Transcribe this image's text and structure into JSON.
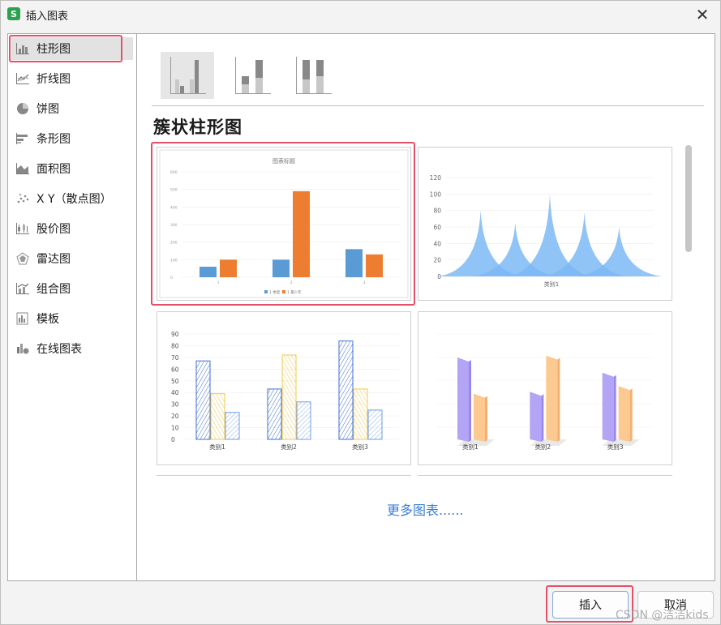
{
  "window": {
    "title": "插入图表",
    "app_icon_letter": "S"
  },
  "sidebar": {
    "items": [
      {
        "label": "柱形图",
        "icon": "bar-chart-icon"
      },
      {
        "label": "折线图",
        "icon": "line-chart-icon"
      },
      {
        "label": "饼图",
        "icon": "pie-chart-icon"
      },
      {
        "label": "条形图",
        "icon": "horizontal-bar-chart-icon"
      },
      {
        "label": "面积图",
        "icon": "area-chart-icon"
      },
      {
        "label": "X Y（散点图）",
        "icon": "scatter-chart-icon"
      },
      {
        "label": "股价图",
        "icon": "stock-chart-icon"
      },
      {
        "label": "雷达图",
        "icon": "radar-chart-icon"
      },
      {
        "label": "组合图",
        "icon": "combo-chart-icon"
      },
      {
        "label": "模板",
        "icon": "template-icon"
      },
      {
        "label": "在线图表",
        "icon": "online-chart-icon"
      }
    ],
    "selected_index": 0
  },
  "main": {
    "section_title": "簇状柱形图",
    "more_link": "更多图表......",
    "thumbs": {
      "t1": {
        "title": "图表标题",
        "ticks": [
          "600",
          "500",
          "400",
          "300",
          "200",
          "100",
          "0"
        ],
        "cats": [
          "1",
          "2",
          "3"
        ],
        "legend": [
          "1 季度",
          "1 最少年"
        ]
      },
      "t2": {
        "ticks": [
          "120",
          "100",
          "80",
          "60",
          "40",
          "20",
          "0"
        ],
        "cat": "类别1"
      },
      "t3": {
        "ticks": [
          "90",
          "80",
          "70",
          "60",
          "50",
          "40",
          "30",
          "20",
          "10",
          "0"
        ],
        "cats": [
          "类别1",
          "类别2",
          "类别3"
        ]
      },
      "t4": {
        "cats": [
          "类别1",
          "类别2",
          "类别3"
        ]
      }
    }
  },
  "chart_data": [
    {
      "type": "bar",
      "title": "图表标题",
      "categories": [
        "1",
        "2",
        "3"
      ],
      "series": [
        {
          "name": "1 季度",
          "values": [
            60,
            100,
            160
          ]
        },
        {
          "name": "1 最少年",
          "values": [
            100,
            490,
            130
          ]
        }
      ],
      "ylim": [
        0,
        600
      ],
      "colors": [
        "#5b9bd5",
        "#ed7d31"
      ]
    },
    {
      "type": "area",
      "categories": [
        "类别1"
      ],
      "peaks": [
        80,
        65,
        100,
        78,
        60
      ],
      "ylim": [
        0,
        120
      ],
      "color": "#7db8f5"
    },
    {
      "type": "bar",
      "categories": [
        "类别1",
        "类别2",
        "类别3"
      ],
      "series": [
        {
          "values": [
            67,
            43,
            84
          ]
        },
        {
          "values": [
            39,
            72,
            43
          ]
        },
        {
          "values": [
            23,
            32,
            25
          ]
        }
      ],
      "ylim": [
        0,
        90
      ],
      "colors": [
        "#3f6fd8",
        "#f2c94c",
        "#6f9de6"
      ]
    },
    {
      "type": "bar",
      "categories": [
        "类别1",
        "类别2",
        "类别3"
      ],
      "series": [
        {
          "values": [
            4.3,
            2.5,
            3.5
          ]
        },
        {
          "values": [
            2.4,
            4.4,
            2.8
          ]
        }
      ],
      "colors": [
        "#b3a4f5",
        "#fcc990"
      ]
    }
  ],
  "footer": {
    "insert_label": "插入",
    "cancel_label": "取消"
  },
  "watermark": "CSDN @洁洁kids"
}
